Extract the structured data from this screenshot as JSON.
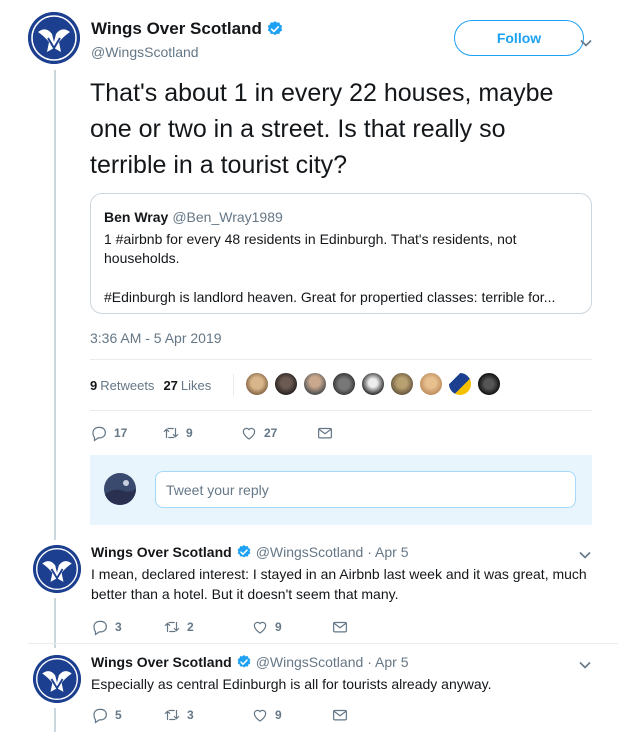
{
  "colors": {
    "accent": "#1da1f2",
    "secondary_text": "#657786",
    "border": "#ccd6dd",
    "reply_bg": "#e8f5fd"
  },
  "main_tweet": {
    "author_name": "Wings Over Scotland",
    "author_handle": "@WingsScotland",
    "follow_label": "Follow",
    "text": "That's about 1 in every 22 houses, maybe one or two in a street. Is that really so terrible in a tourist city?",
    "quoted": {
      "name": "Ben Wray",
      "handle": "@Ben_Wray1989",
      "line1": "1 #airbnb for every 48 residents in Edinburgh. That's residents, not",
      "line2": "households.",
      "line3": "#Edinburgh is landlord heaven. Great for propertied classes: terrible for..."
    },
    "timestamp": "3:36 AM - 5 Apr 2019",
    "retweets_count": "9",
    "retweets_label": "Retweets",
    "likes_count": "27",
    "likes_label": "Likes",
    "likers": [
      "liker-1",
      "liker-2",
      "liker-3",
      "liker-4",
      "liker-5",
      "liker-6",
      "liker-7",
      "liker-8",
      "liker-9"
    ],
    "actions": {
      "replies": "17",
      "retweets": "9",
      "likes": "27"
    }
  },
  "reply_box": {
    "placeholder": "Tweet your reply"
  },
  "replies": [
    {
      "author_name": "Wings Over Scotland",
      "author_handle": "@WingsScotland",
      "date": "· Apr 5",
      "text": "I mean, declared interest: I stayed in an Airbnb last week and it was great, much better than a hotel. But it doesn't seem that many.",
      "actions": {
        "replies": "3",
        "retweets": "2",
        "likes": "9"
      }
    },
    {
      "author_name": "Wings Over Scotland",
      "author_handle": "@WingsScotland",
      "date": "· Apr 5",
      "text": "Especially as central Edinburgh is all for tourists already anyway.",
      "actions": {
        "replies": "5",
        "retweets": "3",
        "likes": "9"
      }
    }
  ]
}
